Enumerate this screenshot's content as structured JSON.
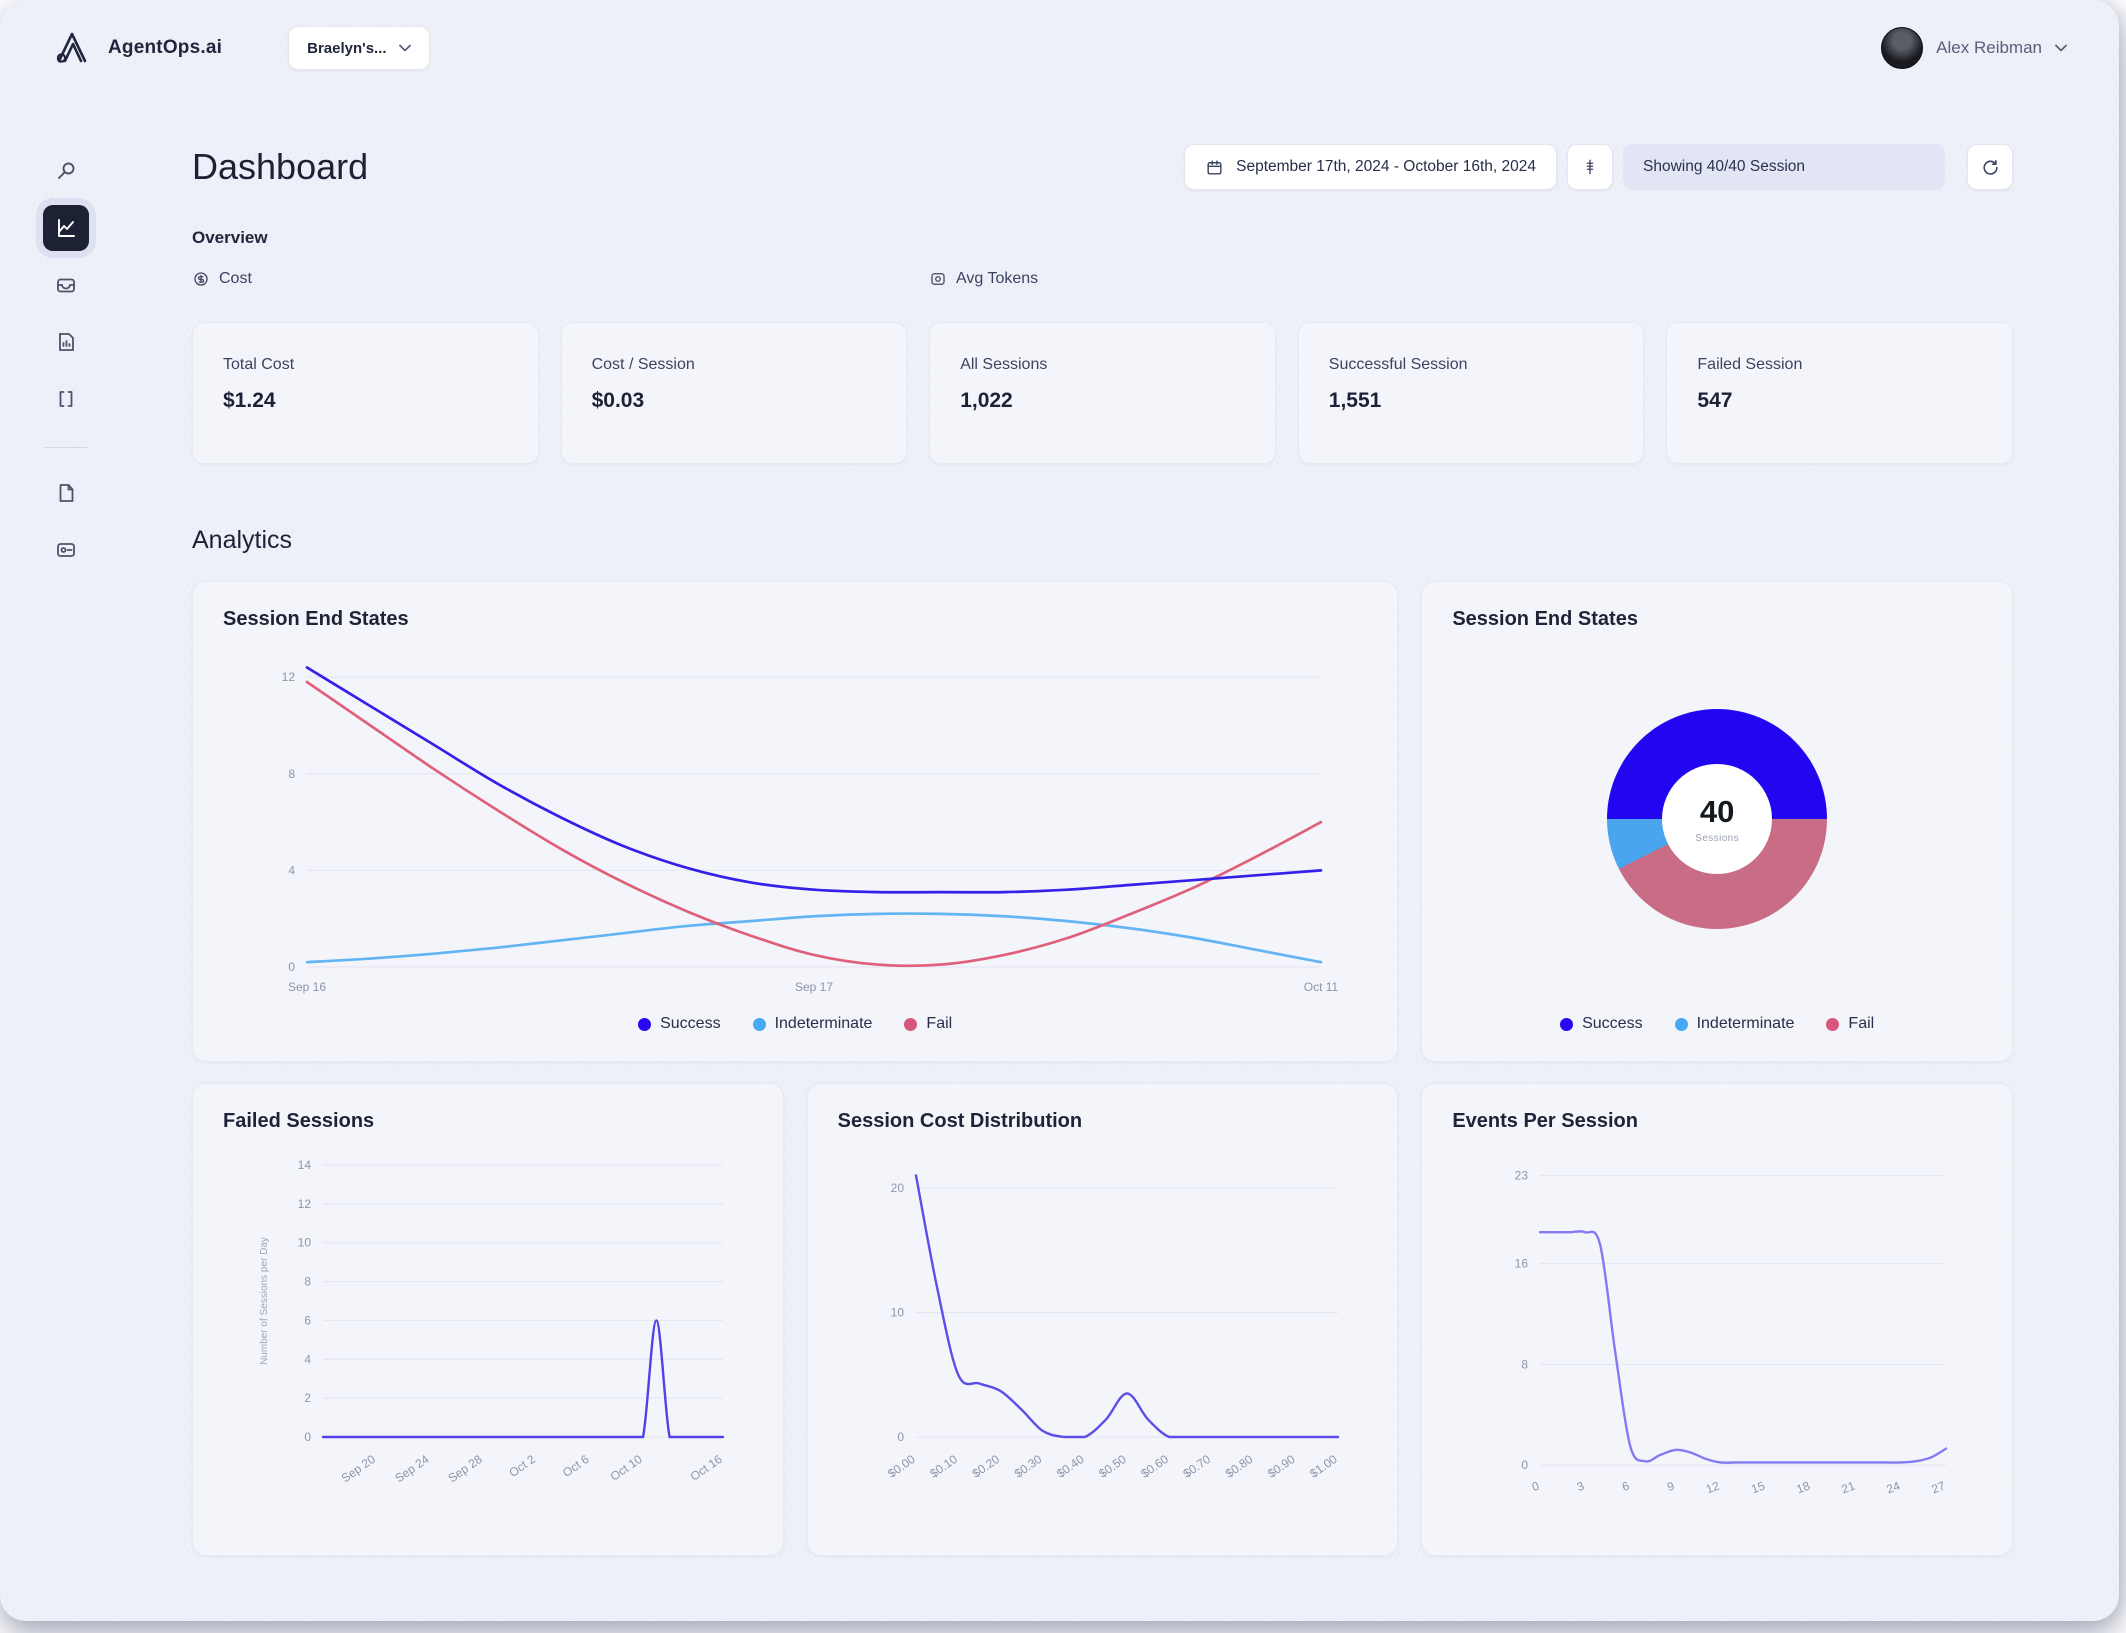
{
  "topbar": {
    "brand": "AgentOps.ai",
    "workspace": "Braelyn's...",
    "user_name": "Alex Reibman"
  },
  "header": {
    "title": "Dashboard",
    "date_range": "September 17th, 2024 - October 16th, 2024",
    "showing": "Showing 40/40 Session"
  },
  "sidebar": {
    "items": [
      {
        "name": "search",
        "active": false
      },
      {
        "name": "dashboard",
        "active": true
      },
      {
        "name": "sessions",
        "active": false
      },
      {
        "name": "projects",
        "active": false
      },
      {
        "name": "traces",
        "active": false
      },
      {
        "name": "docs",
        "active": false
      },
      {
        "name": "api-keys",
        "active": false
      }
    ]
  },
  "overview": {
    "label": "Overview",
    "cost_label": "Cost",
    "avg_tokens_label": "Avg Tokens",
    "cards": [
      {
        "label": "Total Cost",
        "value": "$1.24"
      },
      {
        "label": "Cost / Session",
        "value": "$0.03"
      },
      {
        "label": "All Sessions",
        "value": "1,022"
      },
      {
        "label": "Successful Session",
        "value": "1,551"
      },
      {
        "label": "Failed Session",
        "value": "547"
      }
    ]
  },
  "analytics": {
    "heading": "Analytics"
  },
  "colors": {
    "success": "#2708f0",
    "indeterminate": "#47a8f3",
    "fail": "#d8577c",
    "donut_success": "#2306f0",
    "donut_indeterminate": "#4aa5ee",
    "donut_fail": "#c96d86",
    "single_line": "#5a4fe8",
    "events_line": "#837bf2",
    "failed_line": "#4f42e9"
  },
  "chart_data": [
    {
      "type": "line",
      "title": "Session End States",
      "ylim": [
        0,
        13
      ],
      "yticks": [
        0,
        4,
        8,
        12
      ],
      "xticks": [
        {
          "l": "Sep 16",
          "f": 0
        },
        {
          "l": "Sep 17",
          "f": 0.5
        },
        {
          "l": "Oct 11",
          "f": 1
        }
      ],
      "legend": [
        {
          "label": "Success",
          "color": "#2708f0"
        },
        {
          "label": "Indeterminate",
          "color": "#47a8f3"
        },
        {
          "label": "Fail",
          "color": "#d8577c"
        }
      ],
      "series": [
        {
          "name": "Indeterminate",
          "color": "#62b5f2",
          "values": [
            0.2,
            0.35,
            0.55,
            0.8,
            1.1,
            1.4,
            1.7,
            1.9,
            2.1,
            2.2,
            2.2,
            2.1,
            1.9,
            1.6,
            1.2,
            0.7,
            0.2
          ]
        },
        {
          "name": "Fail",
          "color": "#e0607c",
          "values": [
            11.8,
            10.0,
            8.2,
            6.5,
            4.9,
            3.5,
            2.3,
            1.3,
            0.5,
            0.1,
            0.1,
            0.5,
            1.2,
            2.2,
            3.3,
            4.6,
            6.0
          ]
        },
        {
          "name": "Success",
          "color": "#3420e8",
          "values": [
            12.4,
            10.8,
            9.2,
            7.6,
            6.2,
            5.0,
            4.1,
            3.5,
            3.2,
            3.1,
            3.1,
            3.1,
            3.2,
            3.4,
            3.6,
            3.8,
            4.0
          ]
        }
      ]
    },
    {
      "type": "pie",
      "title": "Session End States",
      "center_value": "40",
      "center_sub": "Sessions",
      "slices": [
        {
          "label": "Success",
          "value": 20,
          "color": "#2306f0"
        },
        {
          "label": "Fail",
          "value": 17,
          "color": "#c96d86"
        },
        {
          "label": "Indeterminate",
          "value": 3,
          "color": "#4aa5ee"
        }
      ],
      "legend": [
        {
          "label": "Success",
          "color": "#2708f0"
        },
        {
          "label": "Indeterminate",
          "color": "#47a8f3"
        },
        {
          "label": "Fail",
          "color": "#d8577c"
        }
      ]
    },
    {
      "type": "line",
      "title": "Failed Sessions",
      "ylabel": "Number of Sessions per Day",
      "ylim": [
        0,
        14
      ],
      "yticks": [
        0,
        2,
        4,
        6,
        8,
        10,
        12,
        14
      ],
      "xrot": -35,
      "xticks": [
        {
          "l": "Sep 20",
          "f": 0.133
        },
        {
          "l": "Sep 24",
          "f": 0.267
        },
        {
          "l": "Sep 28",
          "f": 0.4
        },
        {
          "l": "Oct 2",
          "f": 0.533
        },
        {
          "l": "Oct 6",
          "f": 0.667
        },
        {
          "l": "Oct 10",
          "f": 0.8
        },
        {
          "l": "Oct 16",
          "f": 1.0
        }
      ],
      "series": [
        {
          "name": "Failed Sessions",
          "color": "#4f42e9",
          "values": [
            0,
            0,
            0,
            0,
            0,
            0,
            0,
            0,
            0,
            0,
            0,
            0,
            0,
            0,
            0,
            0,
            0,
            0,
            0,
            0,
            0,
            0,
            0,
            0,
            0,
            6,
            0,
            0,
            0,
            0,
            0
          ]
        }
      ]
    },
    {
      "type": "line",
      "title": "Session Cost Distribution",
      "ylim": [
        0,
        22
      ],
      "yticks": [
        0,
        10,
        20
      ],
      "xrot": -35,
      "xticks": [
        {
          "l": "$0.00",
          "f": 0
        },
        {
          "l": "$0.10",
          "f": 0.1
        },
        {
          "l": "$0.20",
          "f": 0.2
        },
        {
          "l": "$0.30",
          "f": 0.3
        },
        {
          "l": "$0.40",
          "f": 0.4
        },
        {
          "l": "$0.50",
          "f": 0.5
        },
        {
          "l": "$0.60",
          "f": 0.6
        },
        {
          "l": "$0.70",
          "f": 0.7
        },
        {
          "l": "$0.80",
          "f": 0.8
        },
        {
          "l": "$0.90",
          "f": 0.9
        },
        {
          "l": "$1.00",
          "f": 1.0
        }
      ],
      "series": [
        {
          "name": "Sessions",
          "color": "#5a4fe8",
          "values": [
            21,
            12,
            5,
            4.3,
            3.7,
            2.2,
            0.5,
            0,
            0,
            1.4,
            3.5,
            1.4,
            0,
            0,
            0,
            0,
            0,
            0,
            0,
            0,
            0
          ]
        }
      ]
    },
    {
      "type": "line",
      "title": "Events Per Session",
      "ylim": [
        0,
        24
      ],
      "yticks": [
        0,
        8,
        16,
        23
      ],
      "xrot": -20,
      "xticks": [
        {
          "l": "0",
          "f": 0
        },
        {
          "l": "3",
          "f": 0.111
        },
        {
          "l": "6",
          "f": 0.222
        },
        {
          "l": "9",
          "f": 0.333
        },
        {
          "l": "12",
          "f": 0.444
        },
        {
          "l": "15",
          "f": 0.556
        },
        {
          "l": "18",
          "f": 0.667
        },
        {
          "l": "21",
          "f": 0.778
        },
        {
          "l": "24",
          "f": 0.889
        },
        {
          "l": "27",
          "f": 1.0
        }
      ],
      "series": [
        {
          "name": "Events",
          "color": "#837bf2",
          "values": [
            18.5,
            18.5,
            18.5,
            18.5,
            17.5,
            9,
            1.5,
            0.3,
            0.8,
            1.2,
            1.0,
            0.5,
            0.2,
            0.2,
            0.2,
            0.2,
            0.2,
            0.2,
            0.2,
            0.2,
            0.2,
            0.2,
            0.2,
            0.2,
            0.2,
            0.3,
            0.6,
            1.3
          ]
        }
      ]
    }
  ]
}
